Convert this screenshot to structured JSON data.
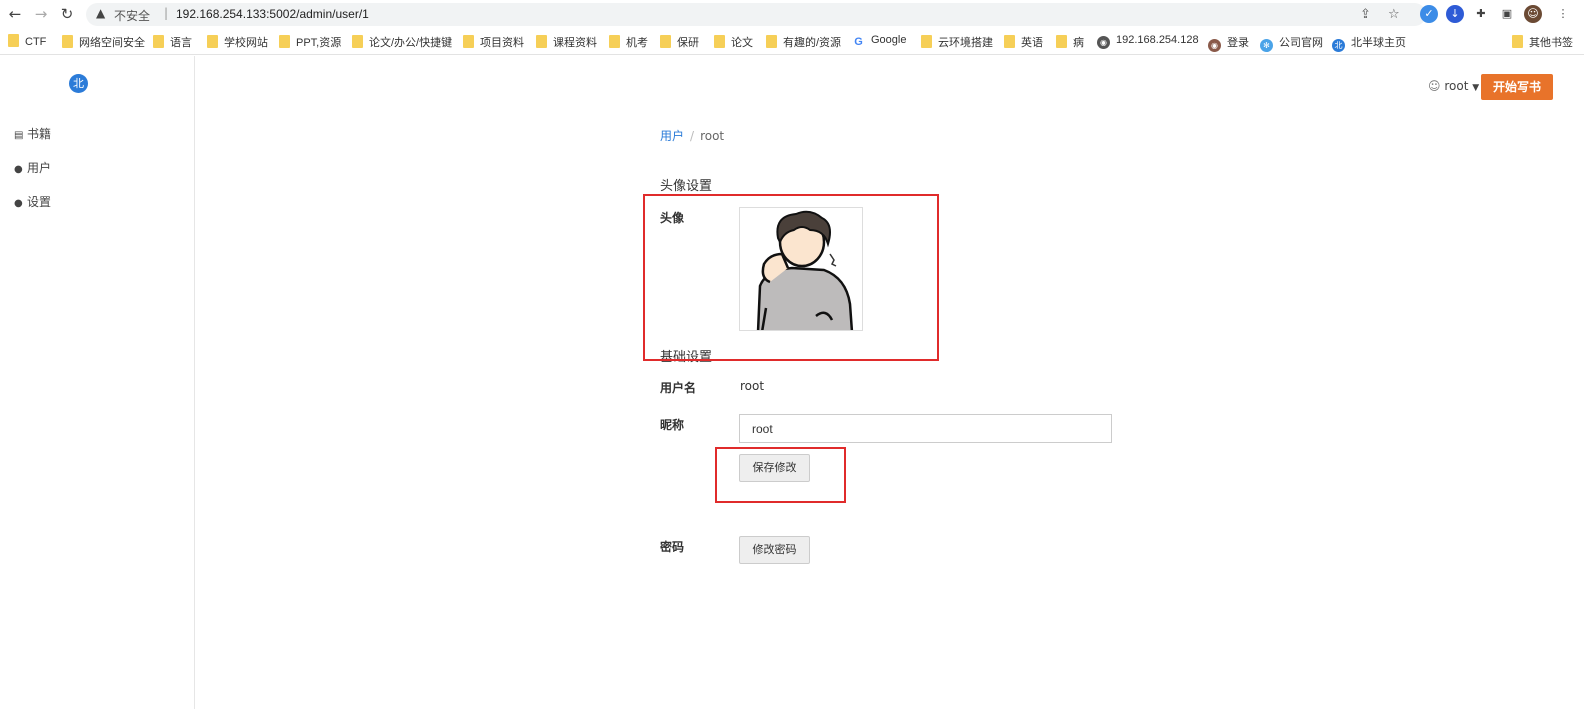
{
  "browser": {
    "security_label": "不安全",
    "url": "192.168.254.133:5002/admin/user/1"
  },
  "bookmarks": [
    "CTF",
    "网络空间安全",
    "语言",
    "学校网站",
    "PPT,资源",
    "论文/办公/快捷键",
    "项目资料",
    "课程资料",
    "机考",
    "保研",
    "论文",
    "有趣的/资源",
    "Google",
    "云环境搭建",
    "英语",
    "病",
    "192.168.254.128",
    "登录",
    "公司官网",
    "北半球主页",
    "其他书签"
  ],
  "sidebar": {
    "logo": "北",
    "items": [
      {
        "label": "书籍",
        "icon": "book-icon"
      },
      {
        "label": "用户",
        "icon": "user-icon"
      },
      {
        "label": "设置",
        "icon": "user-icon"
      }
    ]
  },
  "header": {
    "username": "root",
    "start_button": "开始写书"
  },
  "breadcrumb": {
    "parent": "用户",
    "current": "root"
  },
  "avatar_section": {
    "title": "头像设置",
    "label": "头像"
  },
  "basic_section": {
    "title": "基础设置",
    "username_label": "用户名",
    "username_value": "root",
    "nickname_label": "昵称",
    "nickname_value": "root",
    "save_button": "保存修改",
    "password_label": "密码",
    "change_password_button": "修改密码"
  },
  "colors": {
    "accent": "#e8732a",
    "link": "#2b7bd8",
    "highlight": "#e02b2b"
  }
}
